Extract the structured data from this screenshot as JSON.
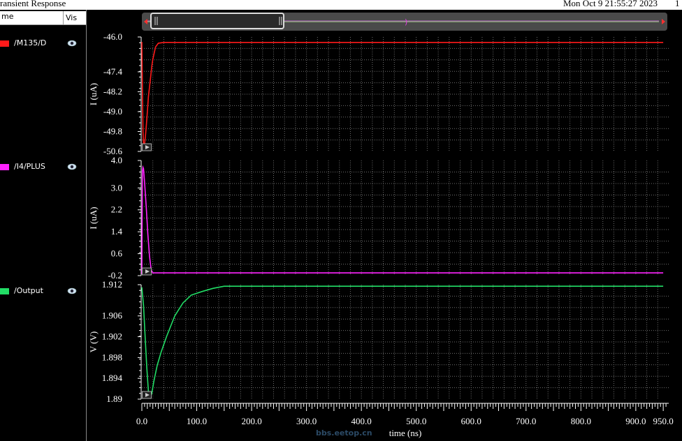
{
  "window": {
    "title": "ransient Response",
    "date": "Mon Oct 9 21:55:27 2023",
    "trail": "1"
  },
  "legend": {
    "col_name": "me",
    "col_vis": "Vis",
    "signals": [
      {
        "name": "/M135/D",
        "color": "#ff1a1a"
      },
      {
        "name": "/I4/PLUS",
        "color": "#ff22ff"
      },
      {
        "name": "/Output",
        "color": "#22dd66"
      }
    ]
  },
  "watermark": "bbs.eetop.cn",
  "colors": {
    "grid": "#6d6d6d",
    "axis": "#ffffff",
    "bg": "#000000"
  },
  "chart_data": [
    {
      "type": "line",
      "series_name": "/M135/D",
      "ylabel": "I (uA)",
      "ylim": [
        -50.6,
        -46.0
      ],
      "yticks": [
        "-46.0",
        "-47.4",
        "-48.2",
        "-49.0",
        "-49.8",
        "-50.6"
      ],
      "ytick_values": [
        -46.0,
        -47.4,
        -48.2,
        -49.0,
        -49.8,
        -50.6
      ],
      "color": "#ff1a1a",
      "x": [
        0,
        1,
        2,
        3.5,
        5,
        6.5,
        8,
        10,
        12,
        14,
        16,
        18,
        20,
        25,
        30,
        40,
        60,
        100,
        200,
        500,
        950
      ],
      "y": [
        -46.2,
        -48.0,
        -49.8,
        -50.5,
        -50.3,
        -50.0,
        -49.6,
        -49.0,
        -48.4,
        -48.0,
        -47.6,
        -47.2,
        -46.9,
        -46.4,
        -46.25,
        -46.22,
        -46.22,
        -46.22,
        -46.22,
        -46.22,
        -46.22
      ]
    },
    {
      "type": "line",
      "series_name": "/I4/PLUS",
      "ylabel": "I (uA)",
      "ylim": [
        -0.2,
        4.0
      ],
      "yticks": [
        "4.0",
        "3.0",
        "2.2",
        "1.4",
        "0.6",
        "-0.2"
      ],
      "ytick_values": [
        4.0,
        3.0,
        2.2,
        1.4,
        0.6,
        -0.2
      ],
      "color": "#ff22ff",
      "x": [
        0,
        1,
        2,
        3,
        5,
        8,
        11,
        14,
        17,
        20,
        30,
        100,
        500,
        950
      ],
      "y": [
        -0.15,
        3.6,
        3.75,
        3.7,
        3.2,
        2.3,
        1.3,
        0.5,
        0.0,
        -0.1,
        -0.1,
        -0.1,
        -0.1,
        -0.1
      ]
    },
    {
      "type": "line",
      "series_name": "/Output",
      "ylabel": "V (V)",
      "ylim": [
        1.89,
        1.912
      ],
      "yticks": [
        "1.912",
        "1.906",
        "1.902",
        "1.898",
        "1.894",
        "1.89"
      ],
      "ytick_values": [
        1.912,
        1.906,
        1.902,
        1.898,
        1.894,
        1.89
      ],
      "color": "#22dd66",
      "x": [
        0,
        3,
        6,
        9,
        12,
        15,
        18,
        22,
        28,
        35,
        45,
        60,
        75,
        90,
        110,
        130,
        150,
        200,
        500,
        950
      ],
      "y": [
        1.9115,
        1.908,
        1.902,
        1.896,
        1.8915,
        1.8905,
        1.891,
        1.8935,
        1.8965,
        1.899,
        1.902,
        1.906,
        1.9085,
        1.91,
        1.9107,
        1.9113,
        1.9117,
        1.9117,
        1.9117,
        1.9117
      ]
    }
  ],
  "xaxis": {
    "xlabel": "time (ns)",
    "xlim": [
      0,
      960
    ],
    "xtick_values": [
      0,
      100,
      200,
      300,
      400,
      500,
      600,
      700,
      800,
      900,
      950
    ],
    "xticks": [
      "0.0",
      "100.0",
      "200.0",
      "300.0",
      "400.0",
      "500.0",
      "600.0",
      "700.0",
      "800.0",
      "900.0",
      "950.0"
    ]
  }
}
